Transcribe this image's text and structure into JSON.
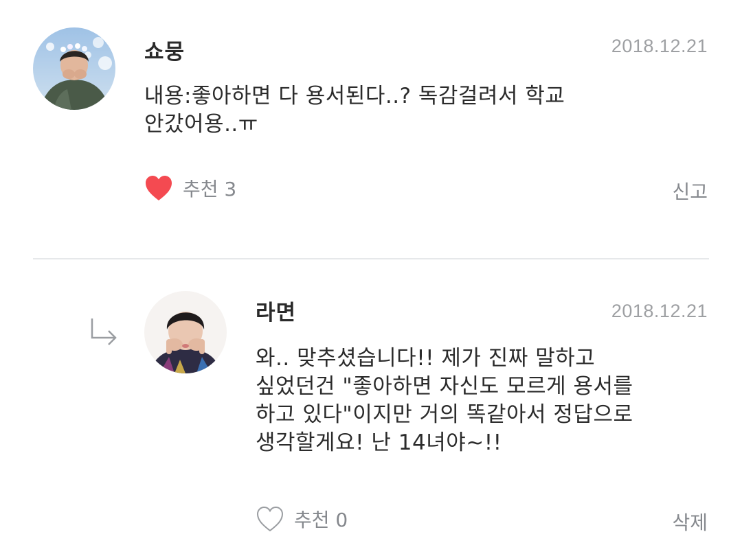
{
  "comments": [
    {
      "author": "쇼뭉",
      "date": "2018.12.21",
      "body_lines": [
        "내용:좋아하면 다 용서된다..? 독감걸려서 학교",
        "안갔어용..ㅠ"
      ],
      "like_label": "추천 3",
      "liked": true,
      "action_label": "신고",
      "heart_icon": "heart-filled-icon"
    },
    {
      "author": "라면",
      "date": "2018.12.21",
      "is_reply": true,
      "body_lines": [
        "와.. 맞추셨습니다!! 제가 진짜 말하고",
        "싶었던건 \"좋아하면 자신도 모르게 용서를",
        "하고 있다\"이지만 거의 똑같아서 정답으로",
        "생각할게요! 난 14녀야~!!"
      ],
      "like_label": "추천 0",
      "liked": false,
      "action_label": "삭제",
      "heart_icon": "heart-outline-icon",
      "reply_icon": "reply-arrow-icon"
    }
  ],
  "colors": {
    "heart_filled": "#f44a51",
    "heart_outline": "#9a9da1",
    "muted_text": "#85888d",
    "date_text": "#9ea0a3",
    "divider": "#e6e8ea"
  }
}
